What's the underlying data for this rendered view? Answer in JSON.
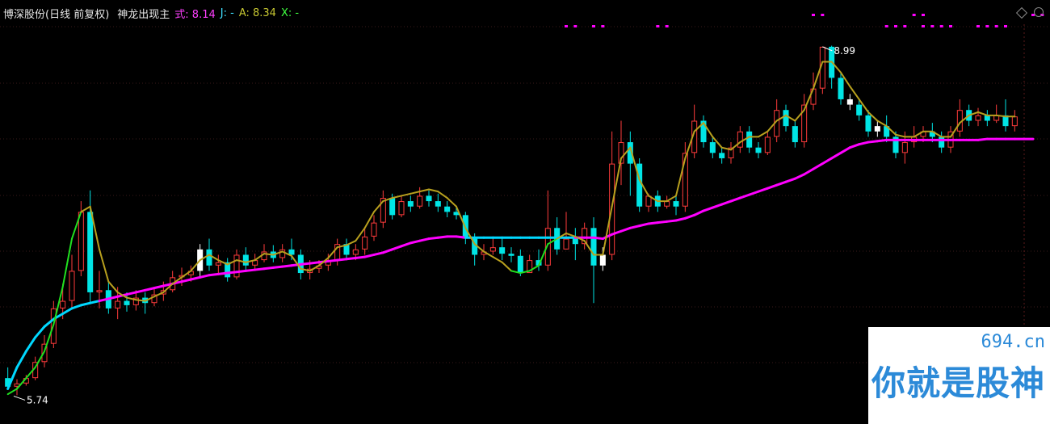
{
  "header": {
    "title": "博深股份(日线 前复权)",
    "indicator": "神龙出现主",
    "shi": "式: 8.14",
    "j": "J: -",
    "a": "A: 8.34",
    "x": "X: -"
  },
  "watermark": {
    "url": "694.cn",
    "text": "你就是股神"
  },
  "chart_data": {
    "type": "candlestick",
    "ylim": [
      5.6,
      9.2
    ],
    "grid": true,
    "annotations": {
      "high_label": "8.99",
      "low_label": "5.74"
    },
    "colors": {
      "up": "#ff3b3b",
      "down": "#00e5e5",
      "signal": "#ffffff",
      "ma_long": "#ff00ff",
      "ma_long_alt": "#00d8ff",
      "ma_short": "#b8a01e",
      "ma_short_alt": "#20e020",
      "marker": "#ff00ff"
    },
    "candles": [
      [
        5.9,
        5.82,
        6.0,
        5.8
      ],
      [
        5.82,
        5.85,
        5.89,
        5.74
      ],
      [
        5.85,
        5.9,
        5.93,
        5.83
      ],
      [
        5.9,
        6.05,
        6.1,
        5.88
      ],
      [
        6.05,
        6.22,
        6.3,
        6.0
      ],
      [
        6.22,
        6.55,
        6.62,
        6.18
      ],
      [
        6.55,
        6.62,
        6.78,
        6.45
      ],
      [
        6.62,
        6.9,
        7.05,
        6.55
      ],
      [
        6.9,
        7.45,
        7.55,
        6.85
      ],
      [
        7.45,
        6.7,
        7.65,
        6.6
      ],
      [
        6.7,
        6.72,
        6.9,
        6.55
      ],
      [
        6.72,
        6.55,
        6.8,
        6.5
      ],
      [
        6.55,
        6.62,
        6.75,
        6.45
      ],
      [
        6.62,
        6.58,
        6.7,
        6.52
      ],
      [
        6.58,
        6.65,
        6.72,
        6.53
      ],
      [
        6.65,
        6.6,
        6.7,
        6.5
      ],
      [
        6.6,
        6.68,
        6.75,
        6.57
      ],
      [
        6.68,
        6.72,
        6.8,
        6.62
      ],
      [
        6.72,
        6.84,
        6.9,
        6.7
      ],
      [
        6.84,
        6.86,
        6.93,
        6.76
      ],
      [
        6.86,
        6.9,
        6.95,
        6.8
      ],
      [
        6.9,
        7.1,
        7.15,
        6.85
      ],
      [
        7.1,
        6.95,
        7.2,
        6.9
      ],
      [
        6.95,
        6.98,
        7.05,
        6.88
      ],
      [
        6.98,
        6.84,
        7.02,
        6.8
      ],
      [
        6.84,
        7.05,
        7.1,
        6.82
      ],
      [
        7.05,
        6.95,
        7.12,
        6.9
      ],
      [
        6.95,
        7.0,
        7.06,
        6.9
      ],
      [
        7.0,
        7.08,
        7.15,
        6.98
      ],
      [
        7.08,
        7.02,
        7.14,
        6.98
      ],
      [
        7.02,
        7.1,
        7.15,
        6.98
      ],
      [
        7.1,
        7.05,
        7.2,
        7.0
      ],
      [
        7.05,
        6.88,
        7.1,
        6.82
      ],
      [
        6.88,
        6.92,
        7.0,
        6.82
      ],
      [
        6.92,
        6.95,
        7.0,
        6.88
      ],
      [
        6.95,
        7.0,
        7.06,
        6.9
      ],
      [
        7.0,
        7.15,
        7.2,
        6.95
      ],
      [
        7.15,
        7.05,
        7.2,
        7.0
      ],
      [
        7.05,
        7.1,
        7.15,
        7.0
      ],
      [
        7.1,
        7.22,
        7.3,
        7.05
      ],
      [
        7.22,
        7.35,
        7.42,
        7.18
      ],
      [
        7.35,
        7.58,
        7.65,
        7.3
      ],
      [
        7.58,
        7.42,
        7.62,
        7.38
      ],
      [
        7.42,
        7.55,
        7.6,
        7.4
      ],
      [
        7.55,
        7.5,
        7.6,
        7.45
      ],
      [
        7.5,
        7.6,
        7.68,
        7.48
      ],
      [
        7.6,
        7.55,
        7.65,
        7.5
      ],
      [
        7.55,
        7.5,
        7.62,
        7.45
      ],
      [
        7.5,
        7.45,
        7.55,
        7.4
      ],
      [
        7.45,
        7.42,
        7.5,
        7.38
      ],
      [
        7.42,
        7.2,
        7.45,
        7.15
      ],
      [
        7.2,
        7.05,
        7.25,
        6.95
      ],
      [
        7.05,
        7.08,
        7.15,
        7.0
      ],
      [
        7.08,
        7.12,
        7.2,
        7.05
      ],
      [
        7.12,
        7.06,
        7.2,
        7.0
      ],
      [
        7.06,
        7.04,
        7.12,
        6.98
      ],
      [
        7.04,
        6.88,
        7.1,
        6.85
      ],
      [
        6.88,
        7.0,
        7.05,
        6.92
      ],
      [
        7.0,
        6.95,
        7.1,
        6.9
      ],
      [
        6.95,
        7.3,
        7.65,
        6.9
      ],
      [
        7.3,
        7.1,
        7.4,
        7.05
      ],
      [
        7.1,
        7.2,
        7.45,
        7.1
      ],
      [
        7.2,
        7.15,
        7.3,
        7.0
      ],
      [
        7.15,
        7.3,
        7.35,
        7.1
      ],
      [
        7.3,
        6.95,
        7.4,
        6.6
      ],
      [
        6.95,
        7.05,
        7.12,
        6.9
      ],
      [
        7.05,
        7.9,
        8.2,
        7.0
      ],
      [
        7.9,
        8.1,
        8.3,
        7.7
      ],
      [
        8.1,
        7.9,
        8.2,
        7.6
      ],
      [
        7.9,
        7.5,
        7.95,
        7.45
      ],
      [
        7.5,
        7.6,
        7.62,
        7.45
      ],
      [
        7.6,
        7.5,
        7.65,
        7.45
      ],
      [
        7.5,
        7.55,
        7.6,
        7.48
      ],
      [
        7.55,
        7.5,
        7.62,
        7.42
      ],
      [
        7.5,
        8.0,
        8.1,
        7.45
      ],
      [
        8.0,
        8.3,
        8.45,
        7.95
      ],
      [
        8.3,
        8.1,
        8.35,
        8.05
      ],
      [
        8.1,
        8.0,
        8.15,
        7.95
      ],
      [
        8.0,
        7.95,
        8.05,
        7.9
      ],
      [
        7.95,
        8.05,
        8.1,
        7.9
      ],
      [
        8.05,
        8.2,
        8.25,
        8.0
      ],
      [
        8.2,
        8.05,
        8.25,
        8.0
      ],
      [
        8.05,
        8.0,
        8.1,
        7.95
      ],
      [
        8.0,
        8.15,
        8.2,
        7.98
      ],
      [
        8.15,
        8.4,
        8.5,
        8.1
      ],
      [
        8.4,
        8.25,
        8.45,
        8.2
      ],
      [
        8.25,
        8.1,
        8.3,
        8.05
      ],
      [
        8.1,
        8.45,
        8.55,
        8.05
      ],
      [
        8.45,
        8.6,
        8.75,
        8.4
      ],
      [
        8.6,
        8.99,
        8.99,
        8.55
      ],
      [
        8.99,
        8.7,
        9.0,
        8.6
      ],
      [
        8.7,
        8.5,
        8.75,
        8.45
      ],
      [
        8.5,
        8.45,
        8.55,
        8.4
      ],
      [
        8.45,
        8.35,
        8.5,
        8.3
      ],
      [
        8.35,
        8.2,
        8.4,
        8.15
      ],
      [
        8.2,
        8.25,
        8.3,
        8.15
      ],
      [
        8.25,
        8.15,
        8.35,
        8.1
      ],
      [
        8.15,
        8.0,
        8.2,
        7.95
      ],
      [
        8.0,
        8.1,
        8.2,
        7.9
      ],
      [
        8.1,
        8.15,
        8.25,
        8.05
      ],
      [
        8.15,
        8.2,
        8.25,
        8.1
      ],
      [
        8.2,
        8.15,
        8.28,
        8.1
      ],
      [
        8.15,
        8.05,
        8.2,
        8.0
      ],
      [
        8.05,
        8.2,
        8.25,
        8.0
      ],
      [
        8.2,
        8.4,
        8.5,
        8.15
      ],
      [
        8.4,
        8.3,
        8.45,
        8.25
      ],
      [
        8.3,
        8.35,
        8.42,
        8.25
      ],
      [
        8.35,
        8.3,
        8.4,
        8.25
      ],
      [
        8.3,
        8.35,
        8.45,
        8.28
      ],
      [
        8.35,
        8.25,
        8.5,
        8.2
      ],
      [
        8.25,
        8.34,
        8.4,
        8.2
      ]
    ],
    "ma_long": [
      5.8,
      6.0,
      6.15,
      6.28,
      6.38,
      6.45,
      6.5,
      6.55,
      6.58,
      6.6,
      6.62,
      6.64,
      6.66,
      6.68,
      6.7,
      6.72,
      6.74,
      6.76,
      6.78,
      6.8,
      6.82,
      6.84,
      6.86,
      6.87,
      6.88,
      6.89,
      6.9,
      6.91,
      6.92,
      6.93,
      6.94,
      6.95,
      6.96,
      6.97,
      6.98,
      6.99,
      7.0,
      7.01,
      7.02,
      7.03,
      7.05,
      7.07,
      7.1,
      7.13,
      7.16,
      7.18,
      7.2,
      7.21,
      7.22,
      7.22,
      7.21,
      7.21,
      7.21,
      7.21,
      7.21,
      7.21,
      7.21,
      7.21,
      7.21,
      7.21,
      7.21,
      7.21,
      7.21,
      7.21,
      7.21,
      7.2,
      7.24,
      7.27,
      7.3,
      7.32,
      7.34,
      7.35,
      7.36,
      7.37,
      7.39,
      7.42,
      7.46,
      7.49,
      7.52,
      7.55,
      7.58,
      7.61,
      7.64,
      7.67,
      7.7,
      7.73,
      7.76,
      7.8,
      7.85,
      7.9,
      7.95,
      8.0,
      8.05,
      8.08,
      8.1,
      8.11,
      8.12,
      8.12,
      8.12,
      8.12,
      8.12,
      8.12,
      8.12,
      8.12,
      8.12,
      8.12,
      8.12,
      8.13,
      8.13,
      8.13,
      8.13,
      8.13,
      8.13
    ],
    "ma_short": [
      5.75,
      5.8,
      5.9,
      6.0,
      6.15,
      6.4,
      6.75,
      7.2,
      7.45,
      7.5,
      7.1,
      6.8,
      6.7,
      6.65,
      6.63,
      6.62,
      6.66,
      6.7,
      6.78,
      6.84,
      6.9,
      7.0,
      7.05,
      7.0,
      6.96,
      7.0,
      6.98,
      7.0,
      7.06,
      7.05,
      7.08,
      7.04,
      6.92,
      6.9,
      6.95,
      7.02,
      7.12,
      7.14,
      7.18,
      7.3,
      7.45,
      7.55,
      7.58,
      7.6,
      7.62,
      7.64,
      7.66,
      7.64,
      7.58,
      7.5,
      7.3,
      7.15,
      7.08,
      7.03,
      6.98,
      6.9,
      6.88,
      6.9,
      6.95,
      7.15,
      7.2,
      7.25,
      7.22,
      7.18,
      7.05,
      7.05,
      7.5,
      7.95,
      8.05,
      7.75,
      7.6,
      7.55,
      7.55,
      7.6,
      7.95,
      8.2,
      8.28,
      8.15,
      8.05,
      8.03,
      8.1,
      8.15,
      8.15,
      8.2,
      8.3,
      8.35,
      8.3,
      8.4,
      8.6,
      8.85,
      8.85,
      8.75,
      8.62,
      8.5,
      8.38,
      8.3,
      8.25,
      8.17,
      8.15,
      8.15,
      8.2,
      8.2,
      8.15,
      8.15,
      8.28,
      8.35,
      8.38,
      8.35,
      8.35,
      8.34,
      8.34
    ],
    "signals": [
      21,
      65,
      92,
      95
    ],
    "marker_rows": [
      [
        88,
        89,
        99,
        100,
        112,
        113,
        116,
        117,
        120,
        121
      ],
      [
        61,
        62,
        64,
        65,
        71,
        72,
        96,
        97,
        98,
        100,
        101,
        102,
        103,
        106,
        107,
        108,
        109
      ]
    ]
  }
}
